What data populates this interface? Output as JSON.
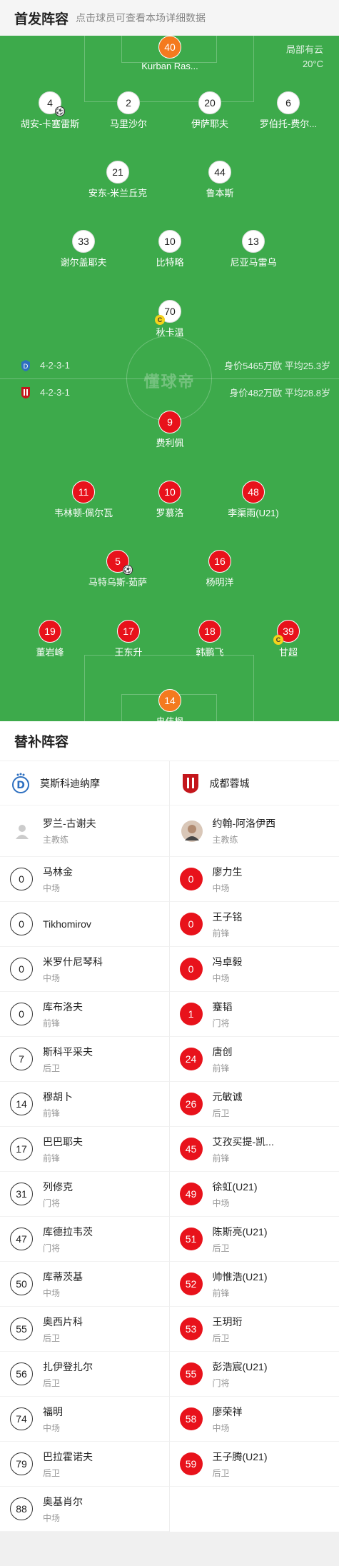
{
  "header": {
    "title": "首发阵容",
    "hint": "点击球员可查看本场详细数据"
  },
  "weather": {
    "desc": "局部有云",
    "temp": "20°C"
  },
  "watermark": "懂球帝",
  "home": {
    "name": "莫斯科迪纳摩",
    "formation": "4-2-3-1",
    "value": "身价5465万欧 平均25.3岁",
    "coach": "罗兰-古谢夫",
    "coach_role": "主教练",
    "lineup": [
      {
        "num": "40",
        "name": "Kurban Ras...",
        "gk": true
      },
      {
        "num": "4",
        "name": "胡安-卡塞雷斯",
        "ball": true
      },
      {
        "num": "2",
        "name": "马里沙尔"
      },
      {
        "num": "20",
        "name": "伊萨耶夫"
      },
      {
        "num": "6",
        "name": "罗伯托-费尔..."
      },
      {
        "num": "21",
        "name": "安东-米兰丘克"
      },
      {
        "num": "44",
        "name": "鲁本斯"
      },
      {
        "num": "33",
        "name": "谢尔盖耶夫"
      },
      {
        "num": "10",
        "name": "比特略"
      },
      {
        "num": "13",
        "name": "尼亚马雷乌"
      },
      {
        "num": "70",
        "name": "秋卡温",
        "captain": true
      }
    ],
    "subs": [
      {
        "num": "0",
        "name": "马林金",
        "pos": "中场"
      },
      {
        "num": "0",
        "name": "Tikhomirov",
        "pos": ""
      },
      {
        "num": "0",
        "name": "米罗什尼琴科",
        "pos": "中场"
      },
      {
        "num": "0",
        "name": "库布洛夫",
        "pos": "前锋"
      },
      {
        "num": "7",
        "name": "斯科平采夫",
        "pos": "后卫"
      },
      {
        "num": "14",
        "name": "穆胡卜",
        "pos": "前锋"
      },
      {
        "num": "17",
        "name": "巴巴耶夫",
        "pos": "前锋"
      },
      {
        "num": "31",
        "name": "列修克",
        "pos": "门将"
      },
      {
        "num": "47",
        "name": "库德拉韦茨",
        "pos": "门将"
      },
      {
        "num": "50",
        "name": "库蒂茨基",
        "pos": "中场"
      },
      {
        "num": "55",
        "name": "奥西片科",
        "pos": "后卫"
      },
      {
        "num": "56",
        "name": "扎伊登扎尔",
        "pos": "后卫"
      },
      {
        "num": "74",
        "name": "福明",
        "pos": "中场"
      },
      {
        "num": "79",
        "name": "巴拉霍诺夫",
        "pos": "后卫"
      },
      {
        "num": "88",
        "name": "奥基肖尔",
        "pos": "中场"
      }
    ]
  },
  "away": {
    "name": "成都蓉城",
    "formation": "4-2-3-1",
    "value": "身价482万欧   平均28.8岁",
    "coach": "约翰-阿洛伊西",
    "coach_role": "主教练",
    "lineup": [
      {
        "num": "9",
        "name": "费利佩"
      },
      {
        "num": "11",
        "name": "韦林顿-佩尔瓦"
      },
      {
        "num": "10",
        "name": "罗慕洛"
      },
      {
        "num": "48",
        "name": "李渠雨(U21)"
      },
      {
        "num": "5",
        "name": "马特乌斯-茹萨",
        "ball": true
      },
      {
        "num": "16",
        "name": "杨明洋"
      },
      {
        "num": "19",
        "name": "董岩峰"
      },
      {
        "num": "17",
        "name": "王东升"
      },
      {
        "num": "18",
        "name": "韩鹏飞"
      },
      {
        "num": "39",
        "name": "甘超",
        "captain": true
      },
      {
        "num": "14",
        "name": "冉伟枫",
        "gk": true
      }
    ],
    "subs": [
      {
        "num": "0",
        "name": "廖力生",
        "pos": "中场"
      },
      {
        "num": "0",
        "name": "王子铭",
        "pos": "前锋"
      },
      {
        "num": "0",
        "name": "冯卓毅",
        "pos": "中场"
      },
      {
        "num": "1",
        "name": "蹇韬",
        "pos": "门将"
      },
      {
        "num": "24",
        "name": "唐创",
        "pos": "前锋"
      },
      {
        "num": "26",
        "name": "元敏诚",
        "pos": "后卫"
      },
      {
        "num": "45",
        "name": "艾孜买提-凯...",
        "pos": "前锋"
      },
      {
        "num": "49",
        "name": "徐虹(U21)",
        "pos": "中场"
      },
      {
        "num": "51",
        "name": "陈斯亮(U21)",
        "pos": "后卫"
      },
      {
        "num": "52",
        "name": "帅惟浩(U21)",
        "pos": "前锋"
      },
      {
        "num": "53",
        "name": "王玥珩",
        "pos": "后卫"
      },
      {
        "num": "55",
        "name": "彭浩宸(U21)",
        "pos": "门将"
      },
      {
        "num": "58",
        "name": "廖荣祥",
        "pos": "中场"
      },
      {
        "num": "59",
        "name": "王子腾(U21)",
        "pos": "后卫"
      }
    ]
  },
  "subs_title": "替补阵容",
  "colors": {
    "pitch": "#3daa4b",
    "home_num": "#ffffff",
    "away_num": "#e8121b",
    "gk": "#f47a1f"
  }
}
